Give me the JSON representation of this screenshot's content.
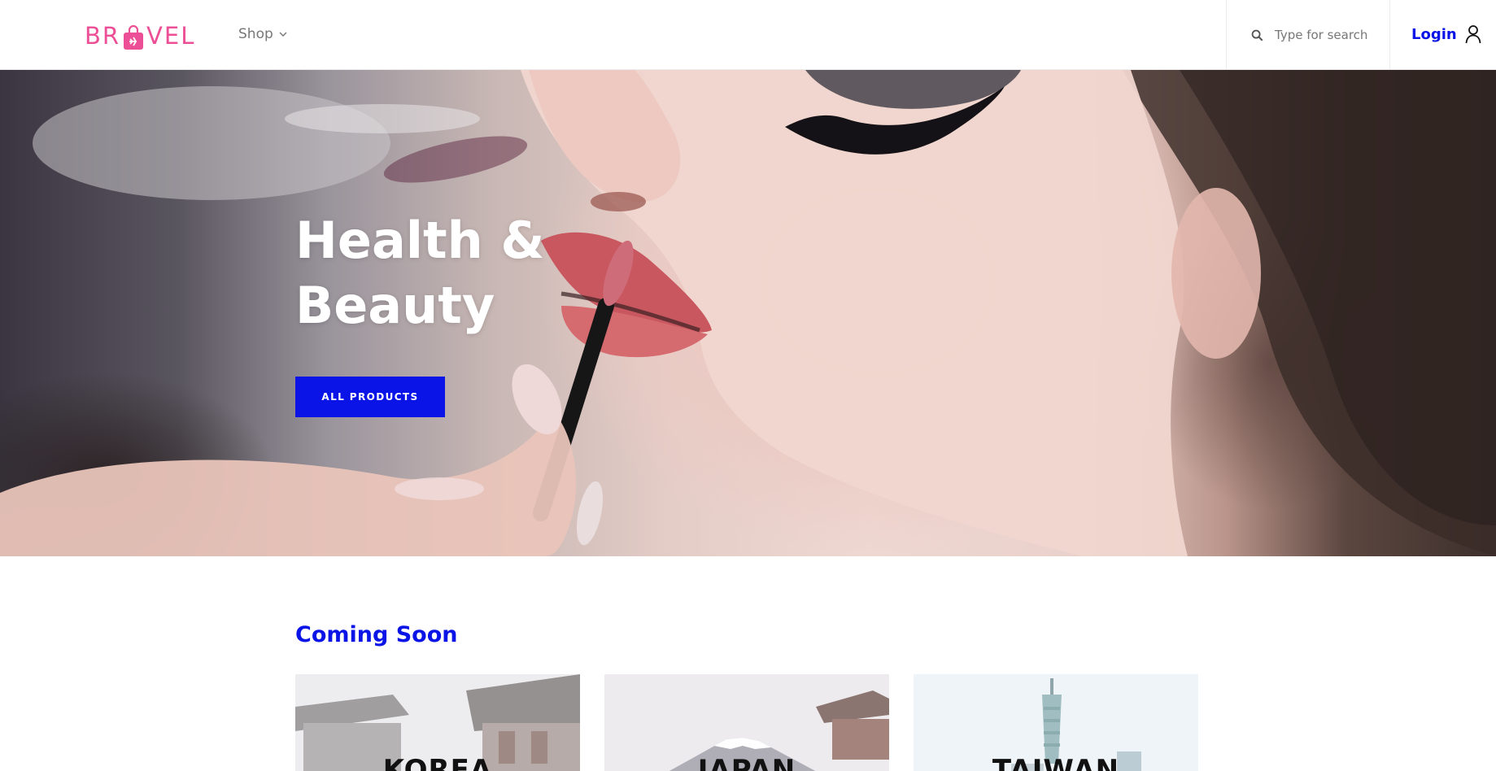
{
  "brand": {
    "logo_prefix": "BR",
    "logo_suffix": "VEL",
    "logo_color": "#ec4f95"
  },
  "nav": {
    "shop_label": "Shop",
    "search_placeholder": "Type for search",
    "login_label": "Login"
  },
  "hero": {
    "title_line1": "Health &",
    "title_line2": "Beauty",
    "button_label": "ALL PRODUCTS",
    "accent_color": "#0a14e6"
  },
  "coming_soon": {
    "title": "Coming Soon",
    "cards": [
      {
        "label": "KOREA"
      },
      {
        "label": "JAPAN"
      },
      {
        "label": "TAIWAN"
      }
    ]
  }
}
